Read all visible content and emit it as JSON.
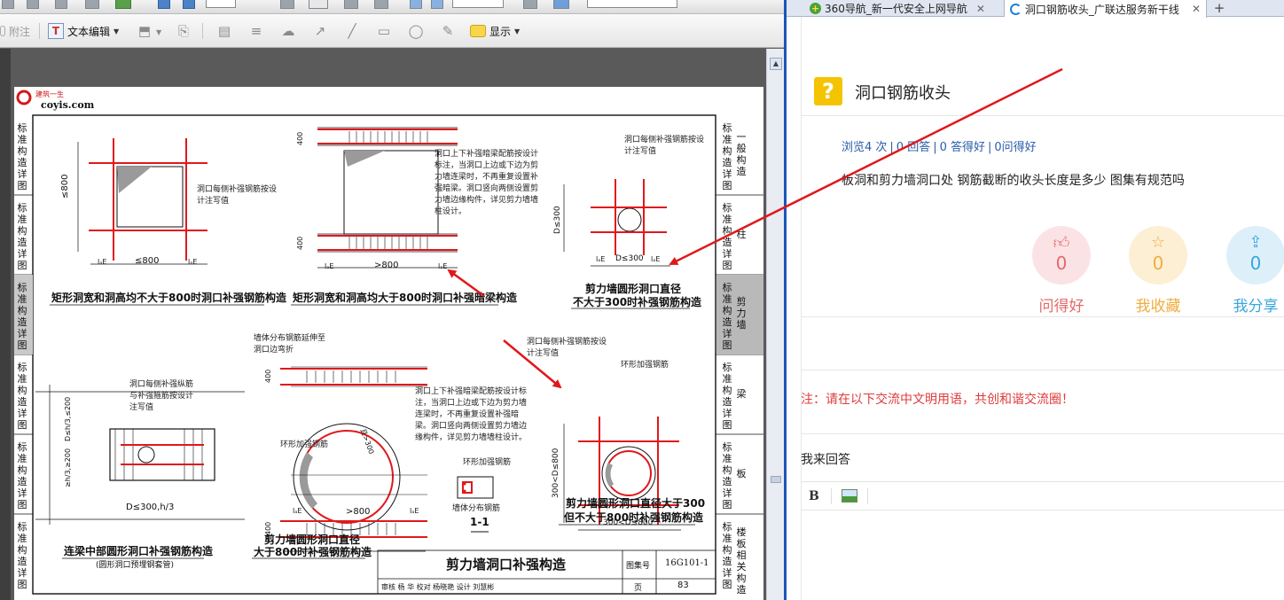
{
  "pdf": {
    "toolbar1": {
      "zoom_value": "",
      "search_placeholder": ""
    },
    "toolbar2": {
      "attach_label": "附注",
      "text_edit_label": "文本编辑",
      "show_label": "显示"
    },
    "drawing": {
      "logo_text": "建筑一生",
      "logo_url": "coyis.com",
      "captions": {
        "c1": "矩形洞宽和洞高均不大于800时洞口补强钢筋构造",
        "c2": "矩形洞宽和洞高均大于800时洞口补强暗梁构造",
        "c3a": "剪力墙圆形洞口直径",
        "c3b": "不大于300时补强钢筋构造",
        "c4": "连梁中部圆形洞口补强钢筋构造",
        "c4sub": "(圆形洞口预埋钢套管)",
        "c5a": "剪力墙圆形洞口直径",
        "c5b": "大于800时补强钢筋构造",
        "c6a": "剪力墙圆形洞口直径大于300",
        "c6b": "但不大于800时补强钢筋构造",
        "section": "1-1"
      },
      "notes": {
        "n1": "洞口每侧补强钢筋按设计注写值",
        "n2": "洞口上下补强暗梁配筋按设计标注，当洞口上边或下边为剪力墙连梁时，不再重复设置补强暗梁。洞口竖向两侧设置剪力墙边缘构件，详见剪力墙墙柱设计。",
        "n3": "洞口每侧补强钢筋按设计注写值",
        "n4": "墙体分布钢筋延伸至洞口边弯折",
        "n5": "洞口上下补强暗梁配筋按设计标注，当洞口上边或下边为剪力墙连梁时，不再重复设置补强暗梁。洞口竖向两侧设置剪力墙边缘构件，详见剪力墙墙柱设计。",
        "n6": "环形加强钢筋",
        "n7": "洞口每侧补强钢筋按设计注写值",
        "n8": "环形加强钢筋",
        "n9": "洞口每侧补强纵筋与补强箍筋按设计注写值",
        "n10": "环形加强钢筋",
        "n11": "墙体分布钢筋"
      },
      "dims": {
        "le800": "≤800",
        "gt800": ">800",
        "d300": "D≤300",
        "d300_800": "300<D≤800",
        "d300h3": "D≤300,h/3",
        "h3": "≥h/3,≥200",
        "d_h3": "D≤h/3,≤200",
        "d400": "400",
        "la": "lₐE",
        "gt300": "且>300"
      },
      "title_block": {
        "title": "剪力墙洞口补强构造",
        "atlas_label": "图集号",
        "atlas_no": "16G101-1",
        "row2": "审核 杨 华 校对 杨晓艳 设计 刘慧彬",
        "page_label": "页",
        "page_no": "83"
      },
      "left_tabs": [
        "标准构造详图",
        "标准构造详图",
        "标准构造详图",
        "标准构造详图",
        "标准构造详图",
        "标准构造详图"
      ],
      "right_tabs": [
        {
          "a": "标准构造详图",
          "b": "一般构造"
        },
        {
          "a": "标准构造详图",
          "b": "柱"
        },
        {
          "a": "标准构造详图",
          "b": "剪力墙"
        },
        {
          "a": "标准构造详图",
          "b": "梁"
        },
        {
          "a": "标准构造详图",
          "b": "板"
        },
        {
          "a": "标准构造详图",
          "b": "楼板相关构造"
        }
      ]
    }
  },
  "browser": {
    "tabs": [
      {
        "label": "360导航_新一代安全上网导航"
      },
      {
        "label": "洞口钢筋收头_广联达服务新干线"
      }
    ],
    "question": {
      "title": "洞口钢筋收头",
      "views": "浏览4 次",
      "answers": "0 回答",
      "good_answers": "0 答得好",
      "asked_good": "0问得好",
      "body": "板洞和剪力墙洞口处 钢筋截断的收头长度是多少 图集有规范吗"
    },
    "actions": [
      {
        "label": "问得好",
        "count": "0",
        "color": "#e36b6b",
        "bg": "#fbe3e5"
      },
      {
        "label": "我收藏",
        "count": "0",
        "color": "#f0ad3e",
        "bg": "#fdefd4"
      },
      {
        "label": "我分享",
        "count": "0",
        "color": "#3aa6dd",
        "bg": "#ddf0fa"
      }
    ],
    "notice": "注：请在以下交流中文明用语，共创和谐交流圈！",
    "reply_label": "我来回答",
    "editor": {
      "bold": "B"
    }
  }
}
